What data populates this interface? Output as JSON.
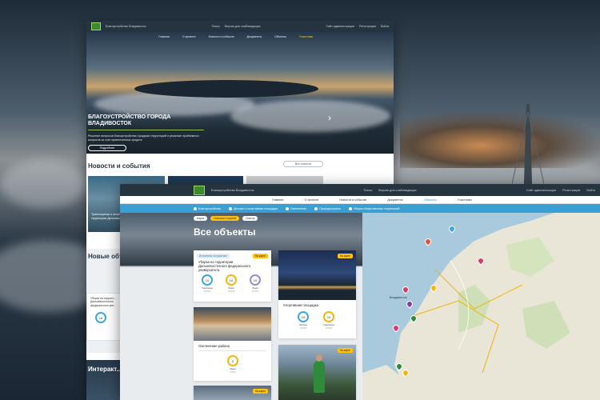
{
  "siteA": {
    "brand": "Благоустройство Владивосток",
    "search": "Поиск",
    "accessibility": "Версия для слабовидящих",
    "admin": "Сайт администрации",
    "register": "Регистрация",
    "login": "Войти",
    "nav": [
      "Главная",
      "О проекте",
      "Новости и события",
      "Документы",
      "Объекты",
      "Участники"
    ],
    "hero_title": "БЛАГОУСТРОЙСТВО ГОРОДА ВЛАДИВОСТОК",
    "hero_sub": "Решение вопросов благоустройства городских территорий и решение проблемных вопросов за счет привлеченных средств",
    "hero_button": "Подробнее",
    "news_title": "Новости и события",
    "all_news": "Все новости",
    "news_card_text": "Транспортная и инженерная ... расположенной на ... территории Дальневосточного",
    "new_objects_title": "Новые объ...",
    "mini_card_text": "Уборка на террито... Дальневосточного федерального уни...",
    "mini_card_value": "16",
    "interactive_title": "Интеракт..."
  },
  "siteB": {
    "brand": "Благоустройство Владивосток",
    "search": "Поиск",
    "accessibility": "Версия для слабовидящих",
    "admin": "Сайт администрации",
    "register": "Регистрация",
    "login": "Войти",
    "nav": [
      "Главная",
      "О проекте",
      "Новости и события",
      "Документы",
      "Объекты",
      "Участники"
    ],
    "filters": [
      "Благоустройство",
      "Детские и спортивные площадки",
      "Озеленение",
      "Природоохрана",
      "Уборка общественных территорий"
    ],
    "chips": [
      "Карта",
      "Списком и картой",
      "Список"
    ],
    "page_title": "Все объекты",
    "cards": [
      {
        "tag": "Исполнено на практике",
        "badge": "На карте",
        "title": "Уборка на территории Дальневосточного федерального университета",
        "stats": [
          {
            "value": "10",
            "label": "Трейлеры",
            "sub": "10/100"
          },
          {
            "value": "10",
            "label": "Люди",
            "sub": "10/100"
          },
          {
            "value": "10",
            "label": "Люди",
            "sub": "10/100"
          }
        ]
      },
      {
        "badge": "На карте",
        "title": "Спортивная площадка",
        "stats": [
          {
            "value": "15",
            "label": "Лопаты",
            "sub": "15/100"
          },
          {
            "value": "10",
            "label": "Трейлеры",
            "sub": "10/100"
          }
        ]
      },
      {
        "title": "Озеленение района",
        "stats": [
          {
            "value": "0",
            "label": "Люди",
            "sub": "0/100"
          }
        ]
      },
      {
        "badge": "На карте"
      },
      {
        "badge": "На карте"
      }
    ],
    "map_city": "Владивосток"
  }
}
